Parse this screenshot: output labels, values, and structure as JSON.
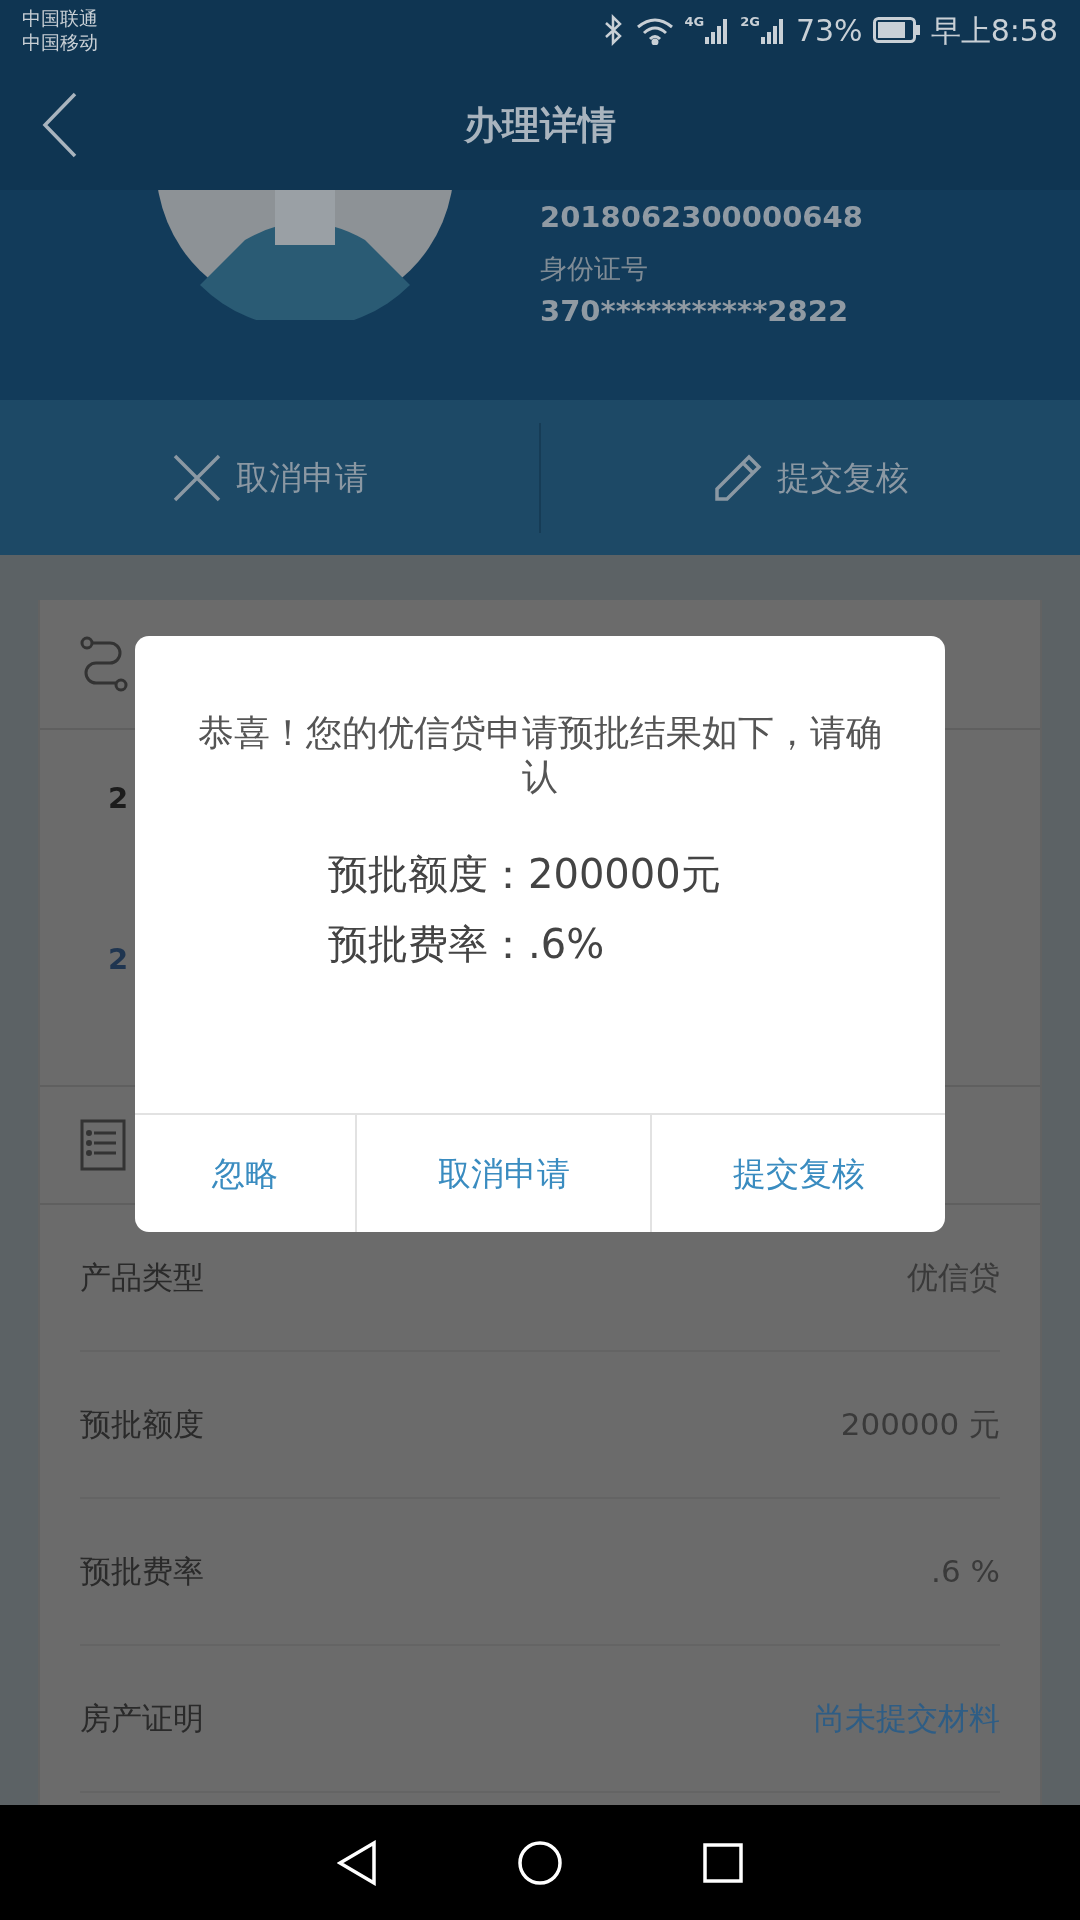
{
  "status_bar": {
    "carriers": [
      "中国联通",
      "中国移动"
    ],
    "network_1": "4G",
    "network_2": "2G",
    "battery": "73%",
    "time": "早上8:58"
  },
  "header": {
    "title": "办理详情"
  },
  "profile": {
    "application_no": "2018062300000648",
    "id_label": "身份证号",
    "id_number": "370***********2822"
  },
  "actions": [
    {
      "label": "取消申请",
      "kind": "cancel"
    },
    {
      "label": "提交复核",
      "kind": "edit"
    }
  ],
  "progress_card": {
    "items": [
      {
        "text": "2",
        "color": "#1c1c1c"
      },
      {
        "text": "2",
        "color": "#1f3550"
      }
    ]
  },
  "details": [
    {
      "label": "产品类型",
      "value": "优信贷",
      "kind": "text"
    },
    {
      "label": "预批额度",
      "value": "200000 元",
      "kind": "text"
    },
    {
      "label": "预批费率",
      "value": ".6 %",
      "kind": "text"
    },
    {
      "label": "房产证明",
      "value": "尚未提交材料",
      "kind": "link"
    }
  ],
  "dialog": {
    "message": "恭喜！您的优信贷申请预批结果如下，请确认",
    "lines": [
      "预批额度：200000元",
      "预批费率：.6%"
    ],
    "buttons": [
      "忽略",
      "取消申请",
      "提交复核"
    ]
  }
}
